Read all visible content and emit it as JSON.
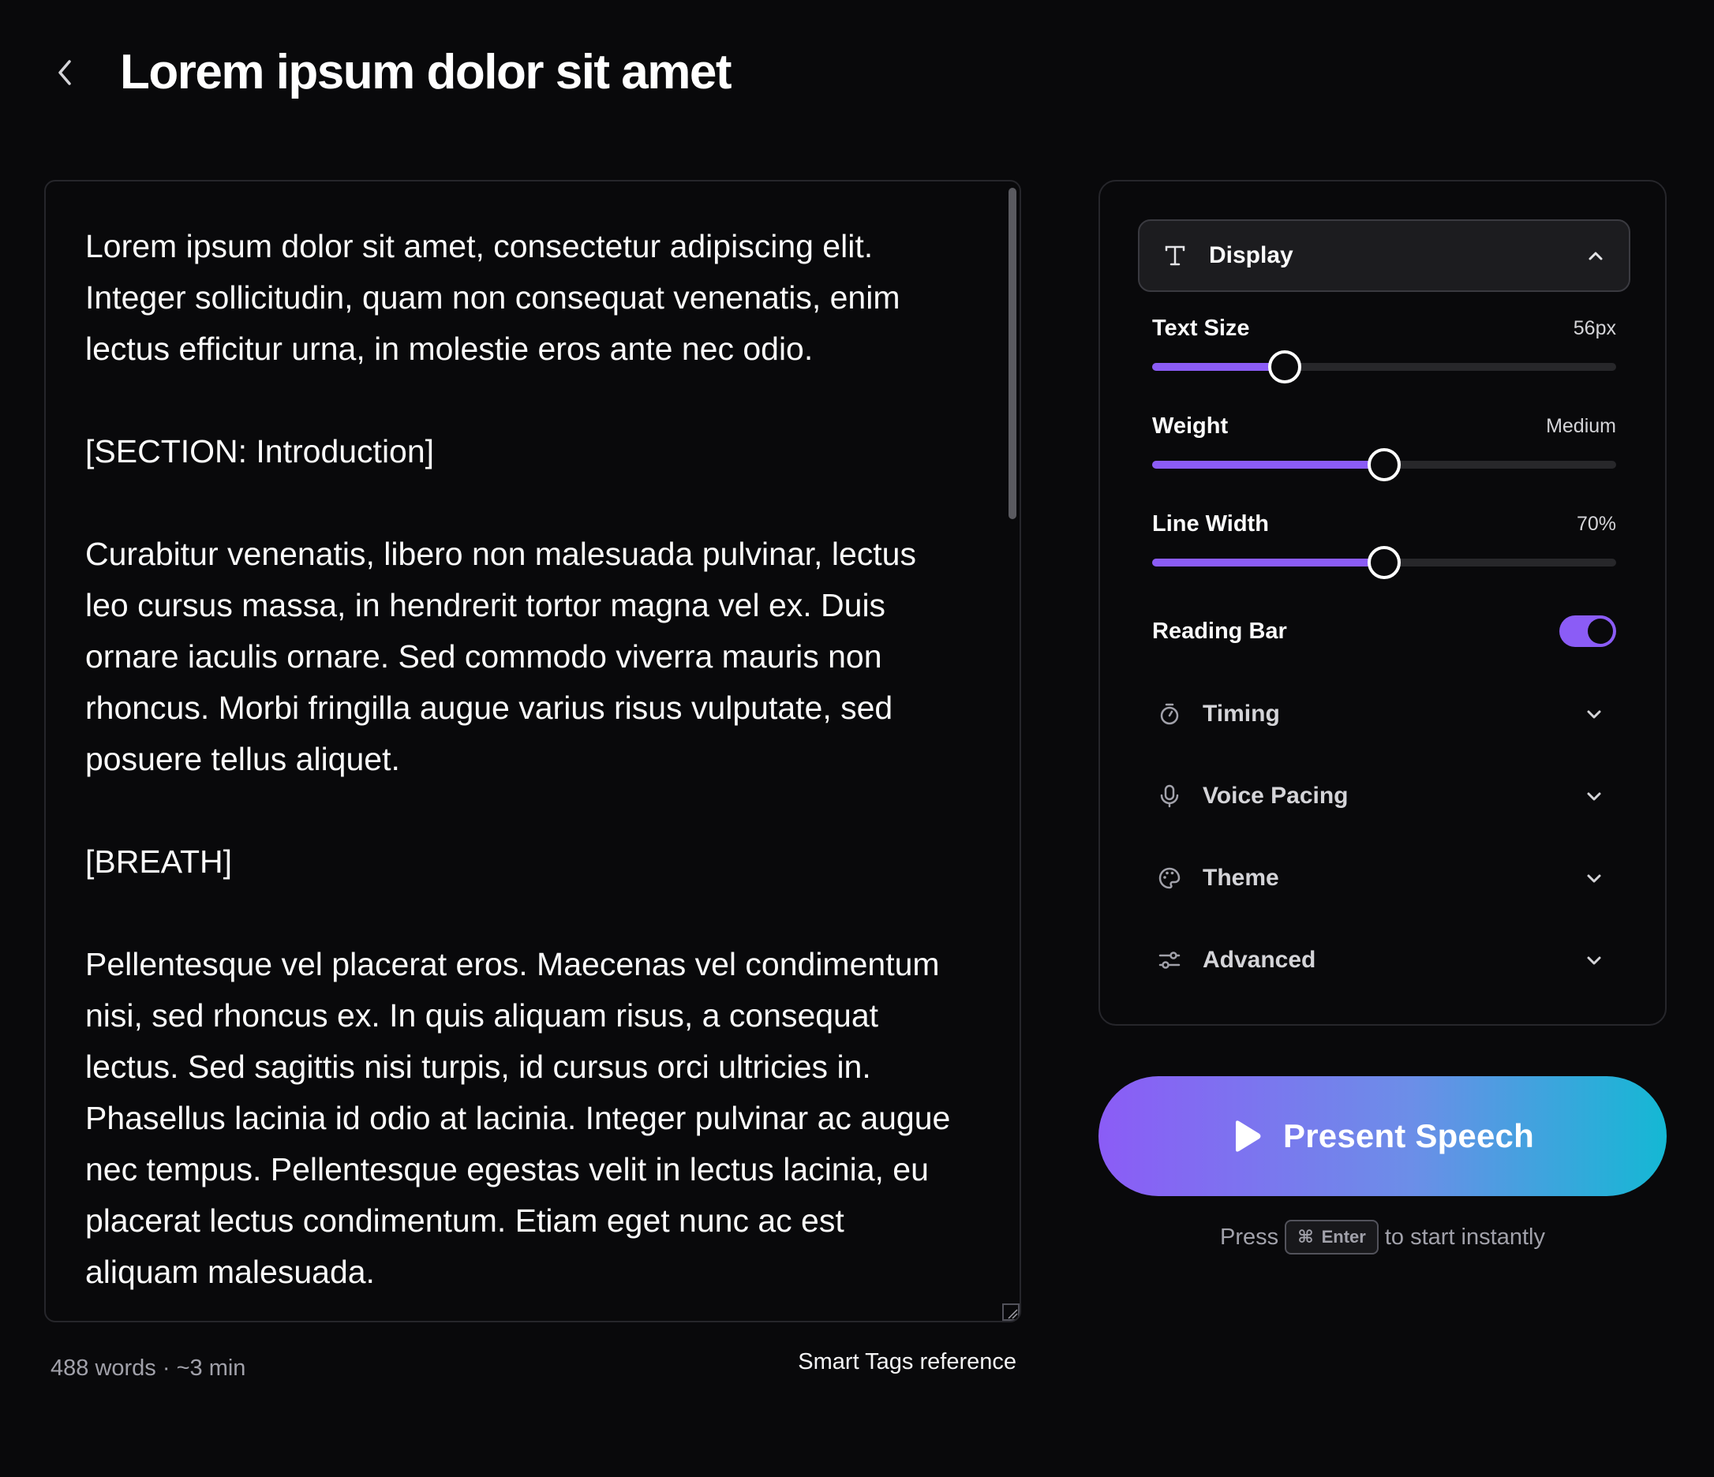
{
  "header": {
    "title": "Lorem ipsum dolor sit amet"
  },
  "editor": {
    "paragraphs": [
      "Lorem ipsum dolor sit amet, consectetur adipiscing elit. Integer sollicitudin, quam non consequat venenatis, enim lectus efficitur urna, in molestie eros ante nec odio.",
      "[SECTION: Introduction]",
      "Curabitur venenatis, libero non malesuada pulvinar, lectus leo cursus massa, in hendrerit tortor magna vel ex. Duis ornare iaculis ornare. Sed commodo viverra mauris non rhoncus. Morbi fringilla augue varius risus vulputate, sed posuere tellus aliquet.",
      "[BREATH]",
      "Pellentesque vel placerat eros. Maecenas vel condimentum nisi, sed rhoncus ex. In quis aliquam risus, a consequat lectus. Sed sagittis nisi turpis, id cursus orci ultricies in. Phasellus lacinia id odio at lacinia. Integer pulvinar ac augue nec tempus. Pellentesque egestas velit in lectus lacinia, eu placerat lectus condimentum. Etiam eget nunc ac est aliquam malesuada."
    ],
    "stats": "488 words · ~3 min",
    "smart_tags_link": "Smart Tags reference"
  },
  "settings": {
    "display": {
      "label": "Display",
      "icon": "text-type-icon",
      "text_size": {
        "label": "Text Size",
        "value": "56px",
        "fraction": 0.285
      },
      "weight": {
        "label": "Weight",
        "value": "Medium",
        "fraction": 0.5
      },
      "line_width": {
        "label": "Line Width",
        "value": "70%",
        "fraction": 0.5
      },
      "reading_bar": {
        "label": "Reading Bar",
        "enabled": true
      }
    },
    "sections": [
      {
        "label": "Timing",
        "icon": "timer-icon"
      },
      {
        "label": "Voice Pacing",
        "icon": "microphone-icon"
      },
      {
        "label": "Theme",
        "icon": "palette-icon"
      },
      {
        "label": "Advanced",
        "icon": "sliders-icon"
      }
    ]
  },
  "present": {
    "label": "Present Speech",
    "hint_prefix": "Press",
    "hint_key_symbol": "⌘",
    "hint_key": "Enter",
    "hint_suffix": "to start instantly"
  },
  "colors": {
    "background": "#09090b",
    "accent": "#8b5cf6",
    "gradient_end": "#14b8d4"
  }
}
